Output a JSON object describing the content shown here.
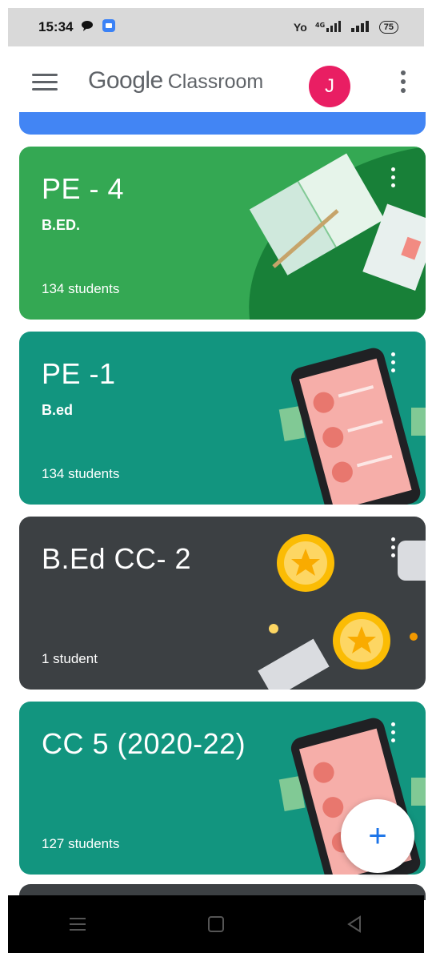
{
  "status_bar": {
    "time": "15:34",
    "network_label": "Yo",
    "signal_label": "4G",
    "battery": "75"
  },
  "app_bar": {
    "title_google": "Google",
    "title_classroom": "Classroom",
    "avatar_initial": "J"
  },
  "classes": [
    {
      "title": "PE - 4",
      "section": "B.ED.",
      "students": "134 students",
      "color": "#34a853"
    },
    {
      "title": "PE -1",
      "section": "B.ed",
      "students": "134 students",
      "color": "#12957f"
    },
    {
      "title": "B.Ed CC- 2",
      "section": "",
      "students": "1 student",
      "color": "#3c4043"
    },
    {
      "title": "CC 5 (2020-22)",
      "section": "",
      "students": "127 students",
      "color": "#12957f"
    }
  ],
  "fab": {
    "icon": "plus-icon",
    "label": "+"
  },
  "nav": {
    "icons": [
      "recent-apps-icon",
      "home-icon",
      "back-icon"
    ]
  }
}
